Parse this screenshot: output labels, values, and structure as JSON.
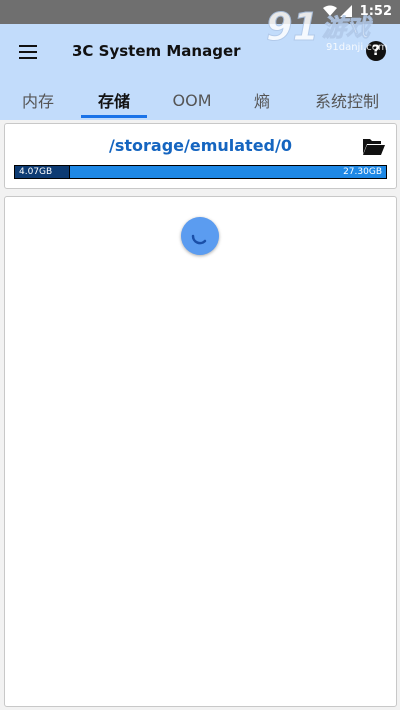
{
  "status_bar": {
    "time": "1:52"
  },
  "watermark": {
    "text": "91游戏",
    "url_text": "91danji.com"
  },
  "app_bar": {
    "title": "3C System Manager",
    "menu_icon": "menu-icon",
    "help_icon": "help-icon",
    "help_label": "?"
  },
  "tabs": [
    {
      "label": "内存",
      "active": false
    },
    {
      "label": "存储",
      "active": true
    },
    {
      "label": "OOM",
      "active": false
    },
    {
      "label": "熵",
      "active": false
    },
    {
      "label": "系统控制",
      "active": false
    }
  ],
  "storage": {
    "path": "/storage/emulated/0",
    "used": "4.07GB",
    "total": "27.30GB",
    "used_fraction": 0.149,
    "folder_icon": "folder-open-icon"
  },
  "content": {
    "loading": true,
    "spinner_icon": "loading-spinner-icon"
  },
  "colors": {
    "app_bar": "#c2dcfb",
    "accent": "#1a73e8",
    "path_text": "#1565c0",
    "bar_free": "#1e88e5",
    "bar_used": "#0d3b73"
  }
}
